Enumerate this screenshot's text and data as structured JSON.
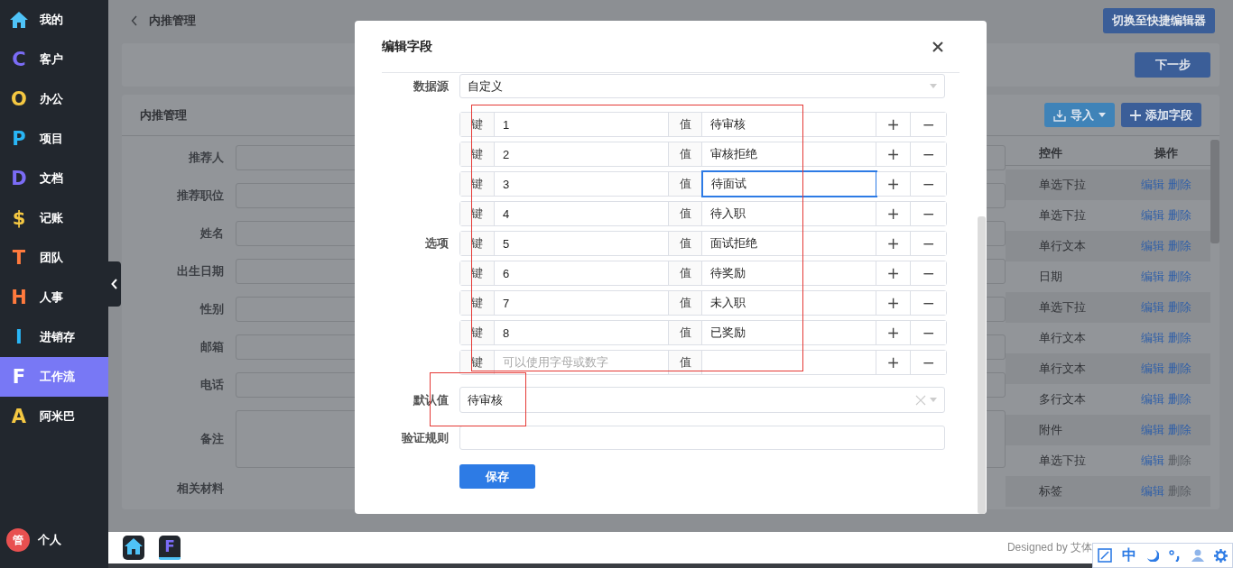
{
  "sidebar": {
    "items": [
      {
        "kind": "house",
        "label": "我的",
        "color": "#4fc3f7",
        "selected": false
      },
      {
        "kind": "letter",
        "glyph": "C",
        "label": "客户",
        "color": "#7b6cf6",
        "selected": false
      },
      {
        "kind": "letter",
        "glyph": "O",
        "label": "办公",
        "color": "#f5c842",
        "selected": false
      },
      {
        "kind": "letter",
        "glyph": "P",
        "label": "项目",
        "color": "#29b6f6",
        "selected": false
      },
      {
        "kind": "letter",
        "glyph": "D",
        "label": "文档",
        "color": "#7b6cf6",
        "selected": false
      },
      {
        "kind": "letter",
        "glyph": "$",
        "label": "记账",
        "color": "#f5c842",
        "selected": false
      },
      {
        "kind": "letter",
        "glyph": "T",
        "label": "团队",
        "color": "#ff7a3d",
        "selected": false
      },
      {
        "kind": "letter",
        "glyph": "H",
        "label": "人事",
        "color": "#ff7a3d",
        "selected": false
      },
      {
        "kind": "letter",
        "glyph": "I",
        "label": "进销存",
        "color": "#29b6f6",
        "selected": false
      },
      {
        "kind": "letter",
        "glyph": "F",
        "label": "工作流",
        "color": "#ffffff",
        "selected": true
      },
      {
        "kind": "letter",
        "glyph": "A",
        "label": "阿米巴",
        "color": "#f5c842",
        "selected": false
      }
    ],
    "user": {
      "avatar": "管",
      "label": "个人"
    }
  },
  "header": {
    "title": "内推管理",
    "button": "切换至快捷编辑器"
  },
  "step_bar": {
    "button": "下一步"
  },
  "card": {
    "title": "内推管理",
    "buttons": [
      {
        "kind": "import",
        "label": "导入"
      },
      {
        "kind": "add",
        "label": "添加字段"
      }
    ],
    "form_fields": [
      {
        "label": "推荐人",
        "kind": "input"
      },
      {
        "label": "推荐职位",
        "kind": "input"
      },
      {
        "label": "姓名",
        "kind": "input"
      },
      {
        "label": "出生日期",
        "kind": "input"
      },
      {
        "label": "性别",
        "kind": "input"
      },
      {
        "label": "邮箱",
        "kind": "input"
      },
      {
        "label": "电话",
        "kind": "input"
      },
      {
        "label": "备注",
        "kind": "textarea"
      },
      {
        "label": "相关材料",
        "kind": "none"
      }
    ],
    "table": {
      "columns": [
        "控件",
        "操作"
      ],
      "rows": [
        {
          "control": "单选下拉",
          "edit": "编辑",
          "delete": "删除",
          "delete_disabled": false
        },
        {
          "control": "单选下拉",
          "edit": "编辑",
          "delete": "删除",
          "delete_disabled": false
        },
        {
          "control": "单行文本",
          "edit": "编辑",
          "delete": "删除",
          "delete_disabled": false
        },
        {
          "control": "日期",
          "edit": "编辑",
          "delete": "删除",
          "delete_disabled": false
        },
        {
          "control": "单选下拉",
          "edit": "编辑",
          "delete": "删除",
          "delete_disabled": false
        },
        {
          "control": "单行文本",
          "edit": "编辑",
          "delete": "删除",
          "delete_disabled": false
        },
        {
          "control": "单行文本",
          "edit": "编辑",
          "delete": "删除",
          "delete_disabled": false
        },
        {
          "control": "多行文本",
          "edit": "编辑",
          "delete": "删除",
          "delete_disabled": false
        },
        {
          "control": "附件",
          "edit": "编辑",
          "delete": "删除",
          "delete_disabled": false
        },
        {
          "control": "单选下拉",
          "edit": "编辑",
          "delete": "删除",
          "delete_disabled": true
        },
        {
          "control": "标签",
          "edit": "编辑",
          "delete": "删除",
          "delete_disabled": true
        }
      ]
    }
  },
  "modal": {
    "title": "编辑字段",
    "data_source": {
      "label": "数据源",
      "value": "自定义"
    },
    "options": {
      "label": "选项",
      "highlighted": true,
      "rows": [
        {
          "key_label": "键",
          "key": "1",
          "value_label": "值",
          "value": "待审核",
          "focused": false,
          "add": "+",
          "remove": "−"
        },
        {
          "key_label": "键",
          "key": "2",
          "value_label": "值",
          "value": "审核拒绝",
          "focused": false,
          "add": "+",
          "remove": "−"
        },
        {
          "key_label": "键",
          "key": "3",
          "value_label": "值",
          "value": "待面试",
          "focused": true,
          "add": "+",
          "remove": "−"
        },
        {
          "key_label": "键",
          "key": "4",
          "value_label": "值",
          "value": "待入职",
          "focused": false,
          "add": "+",
          "remove": "−"
        },
        {
          "key_label": "键",
          "key": "5",
          "value_label": "值",
          "value": "面试拒绝",
          "focused": false,
          "add": "+",
          "remove": "−"
        },
        {
          "key_label": "键",
          "key": "6",
          "value_label": "值",
          "value": "待奖励",
          "focused": false,
          "add": "+",
          "remove": "−"
        },
        {
          "key_label": "键",
          "key": "7",
          "value_label": "值",
          "value": "未入职",
          "focused": false,
          "add": "+",
          "remove": "−"
        },
        {
          "key_label": "键",
          "key": "8",
          "value_label": "值",
          "value": "已奖励",
          "focused": false,
          "add": "+",
          "remove": "−"
        },
        {
          "key_label": "键",
          "key_placeholder": "可以使用字母或数字",
          "value_label": "值",
          "focused": false,
          "add": "+",
          "remove": "−"
        }
      ]
    },
    "default_value": {
      "label": "默认值",
      "value": "待审核",
      "highlighted": true
    },
    "validation": {
      "label": "验证规则"
    },
    "save": "保存"
  },
  "taskbar": {
    "apps": [
      {
        "kind": "house",
        "selected": false
      },
      {
        "kind": "letter",
        "glyph": "F",
        "selected": true
      }
    ],
    "credit": "Designed by 艾体"
  },
  "ime": {
    "mode": "中"
  }
}
